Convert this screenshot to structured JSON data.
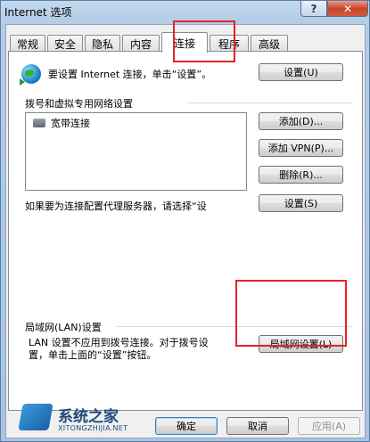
{
  "window": {
    "title": "Internet 选项",
    "help_label": "?",
    "close_label": "✕"
  },
  "tabs": [
    {
      "label": "常规"
    },
    {
      "label": "安全"
    },
    {
      "label": "隐私"
    },
    {
      "label": "内容"
    },
    {
      "label": "连接",
      "active": true
    },
    {
      "label": "程序"
    },
    {
      "label": "高级"
    }
  ],
  "setup": {
    "text": "要设置 Internet 连接，单击“设置”。",
    "button": "设置(U)"
  },
  "dialup": {
    "group_label": "拨号和虚拟专用网络设置",
    "connections": [
      {
        "name": "宽带连接"
      }
    ],
    "add_button": "添加(D)...",
    "add_vpn_button": "添加 VPN(P)...",
    "remove_button": "删除(R)...",
    "proxy_text": "如果要为连接配置代理服务器，请选择“设",
    "settings_button": "设置(S)"
  },
  "lan": {
    "group_label": "局域网(LAN)设置",
    "text_line1": "LAN 设置不应用到拨号连接。对于拨号设",
    "text_line2": "置，单击上面的“设置”按钮。",
    "button": "局域网设置(L)"
  },
  "footer": {
    "ok": "确定",
    "cancel": "取消",
    "apply": "应用(A)"
  },
  "watermark": {
    "name": "系统之家",
    "sub": "XITONGZHIJIA.NET"
  },
  "colors": {
    "highlight": "#e8202a",
    "focus": "#3c7fb1"
  }
}
